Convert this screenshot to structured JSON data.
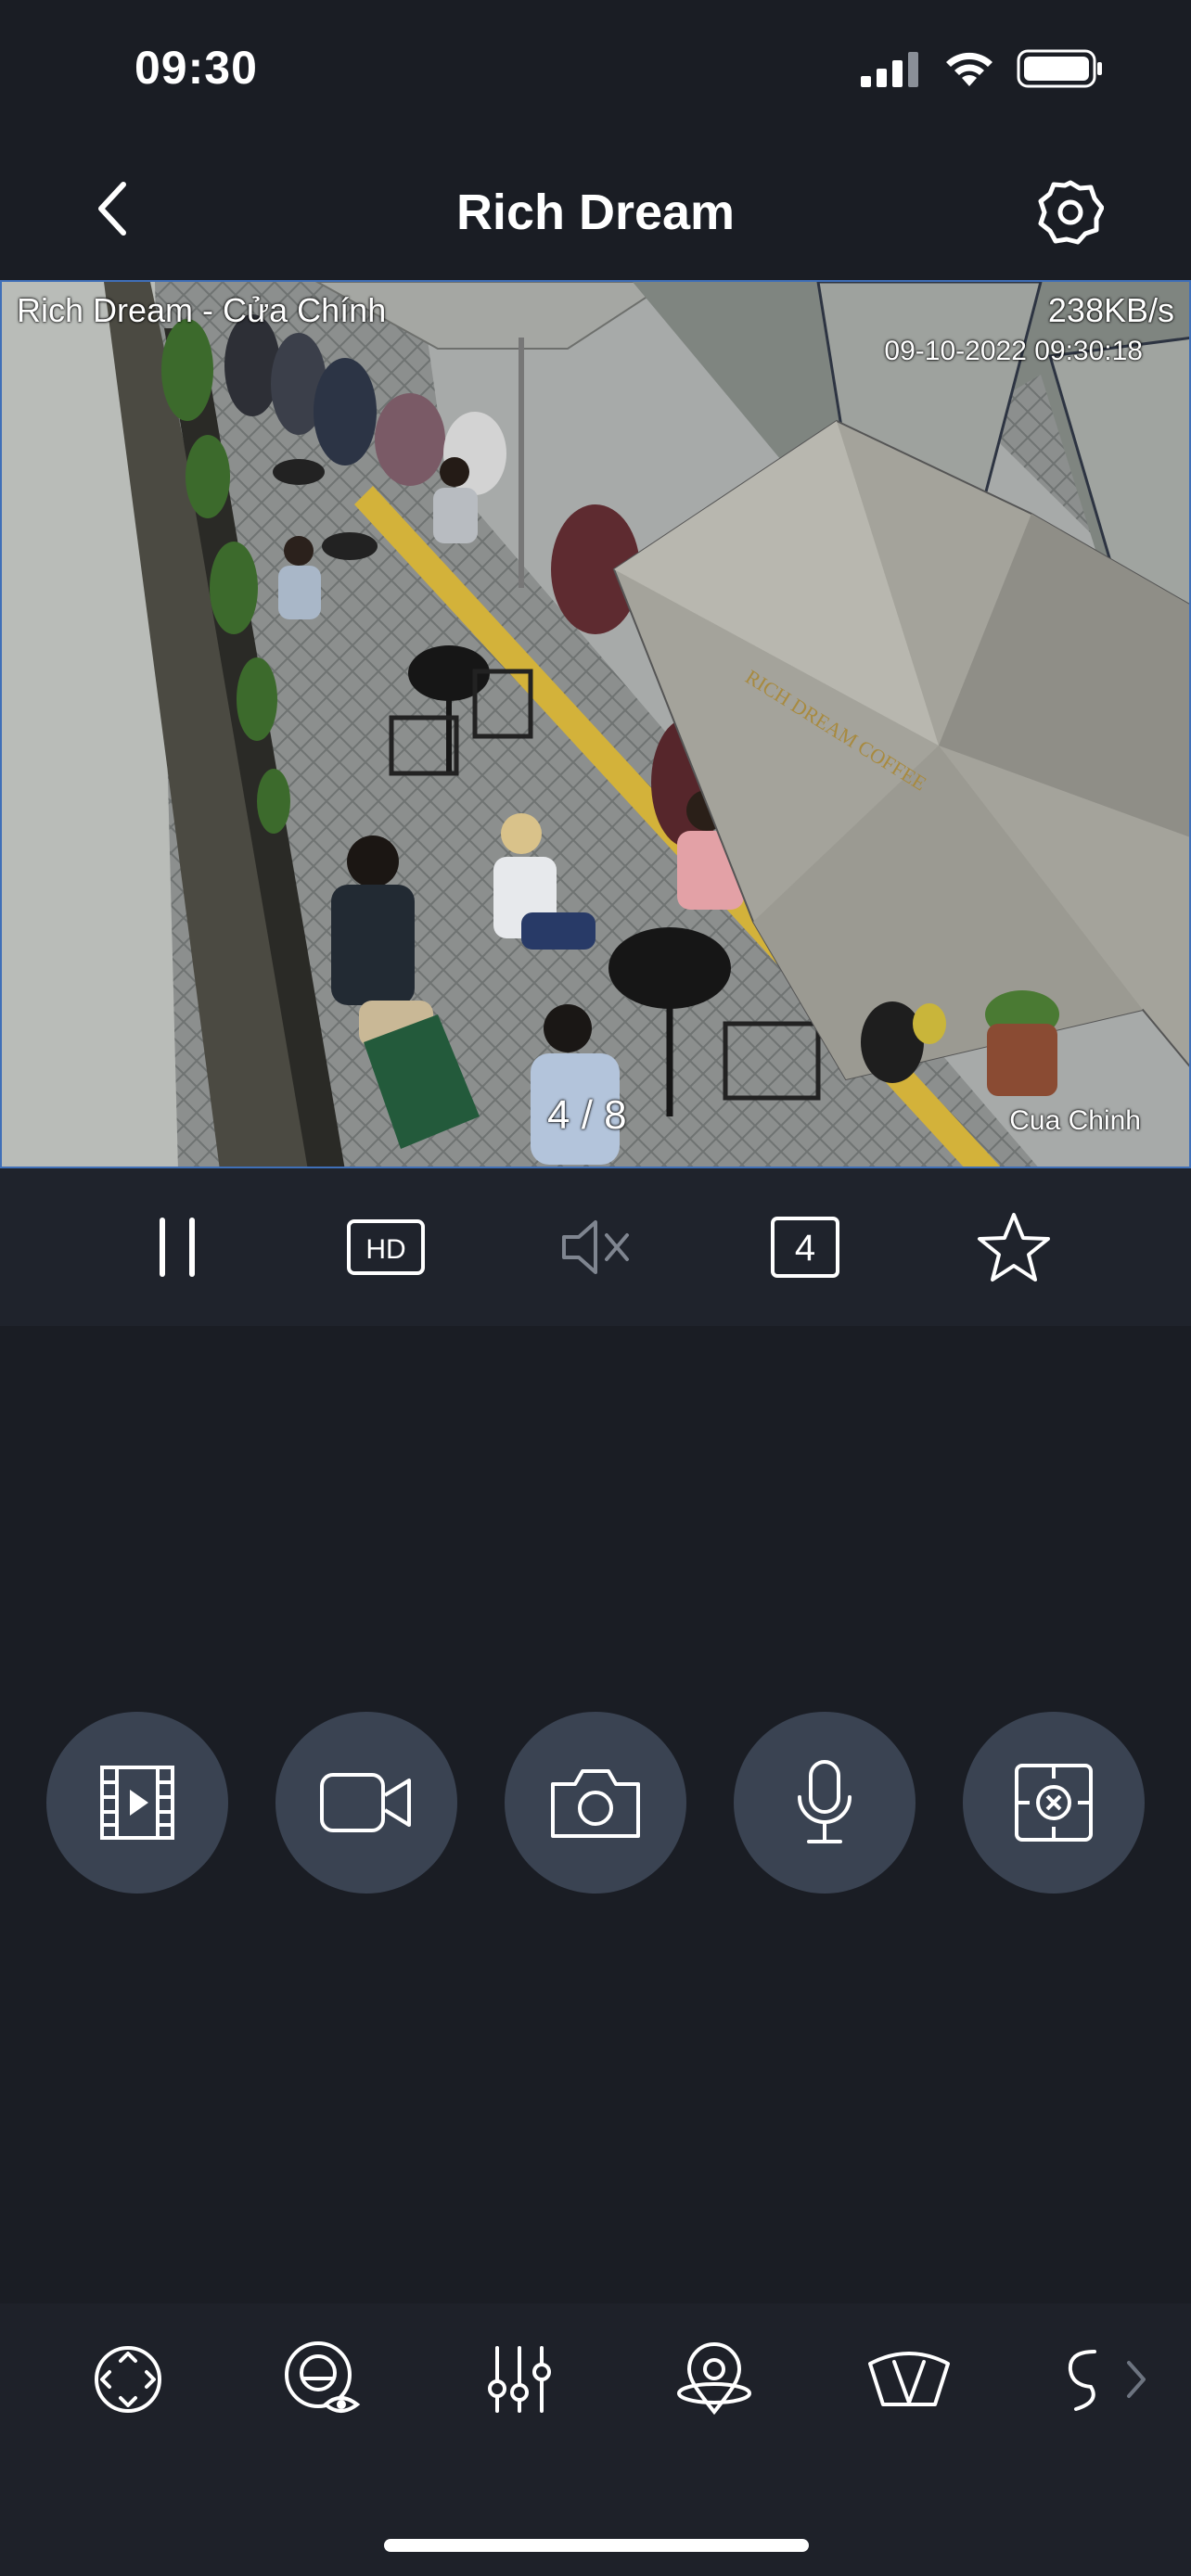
{
  "status_bar": {
    "time": "09:30",
    "icons": [
      "cellular-signal-icon",
      "wifi-icon",
      "battery-icon"
    ]
  },
  "nav": {
    "title": "Rich Dream",
    "back_icon": "chevron-left-icon",
    "settings_icon": "gear-icon"
  },
  "video": {
    "channel_label": "Rich Dream - Cửa Chính",
    "bitrate": "238KB/s",
    "datetime": "09-10-2022 09:30:18",
    "corner_label": "Cua Chinh",
    "page_indicator": "4 / 8",
    "umbrella_text": "RICH DREAM COFFEE"
  },
  "controls": [
    {
      "name": "pause-icon",
      "label": "||"
    },
    {
      "name": "hd-icon",
      "label": "HD"
    },
    {
      "name": "mute-icon"
    },
    {
      "name": "split-4-icon",
      "label": "4"
    },
    {
      "name": "star-icon"
    }
  ],
  "actions": [
    "playback-icon",
    "record-video-icon",
    "snapshot-icon",
    "microphone-icon",
    "close-feed-icon"
  ],
  "bottom_toolbar": [
    "ptz-icon",
    "privacy-eye-icon",
    "adjust-sliders-icon",
    "preset-location-icon",
    "wiper-icon",
    "more-icon"
  ],
  "colors": {
    "background": "#1a1d24",
    "circle_bg": "#3a4352",
    "bar_bg": "#1f232c",
    "video_border": "#3f6fb8"
  }
}
